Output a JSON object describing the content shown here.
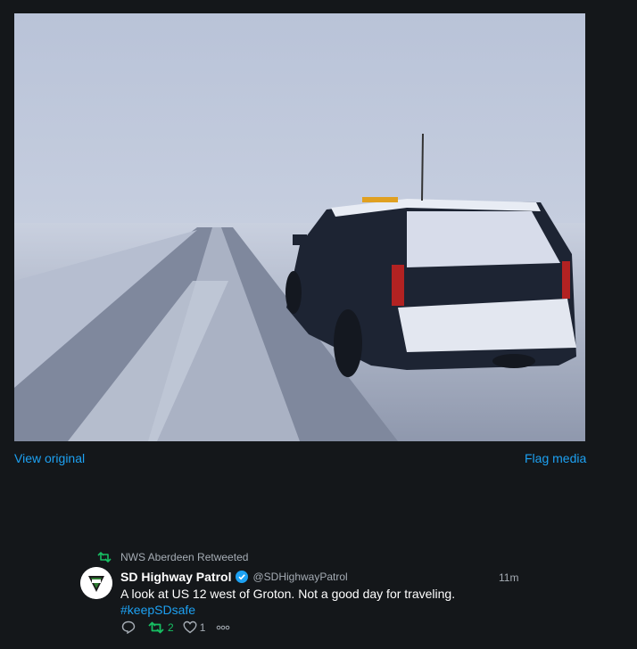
{
  "media": {
    "view_original_label": "View original",
    "flag_media_label": "Flag media"
  },
  "tweet": {
    "retweeted_by": "NWS Aberdeen Retweeted",
    "author_name": "SD Highway Patrol",
    "handle": "@SDHighwayPatrol",
    "timestamp": "11m",
    "text": "A look at US 12 west of Groton. Not a good day for traveling.",
    "hashtag": "#keepSDsafe",
    "retweet_count": "2",
    "like_count": "1"
  },
  "colors": {
    "background": "#14171a",
    "link": "#1da1f2",
    "retweet_green": "#17bf63",
    "muted": "#a5acb4"
  },
  "icons": [
    "retweet-icon",
    "verified-badge-icon",
    "reply-icon",
    "like-icon",
    "more-icon"
  ]
}
